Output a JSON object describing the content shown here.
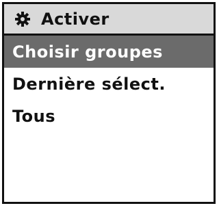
{
  "header": {
    "icon": "gear-icon",
    "title": "Activer"
  },
  "menu": {
    "items": [
      {
        "label": "Choisir groupes",
        "selected": true
      },
      {
        "label": "Dernière sélect.",
        "selected": false
      },
      {
        "label": "Tous",
        "selected": false
      }
    ]
  },
  "colors": {
    "header_bg": "#d9d9d9",
    "selected_bg": "#6b6b6b",
    "selected_text": "#ffffff",
    "text": "#111111",
    "border": "#111111"
  }
}
